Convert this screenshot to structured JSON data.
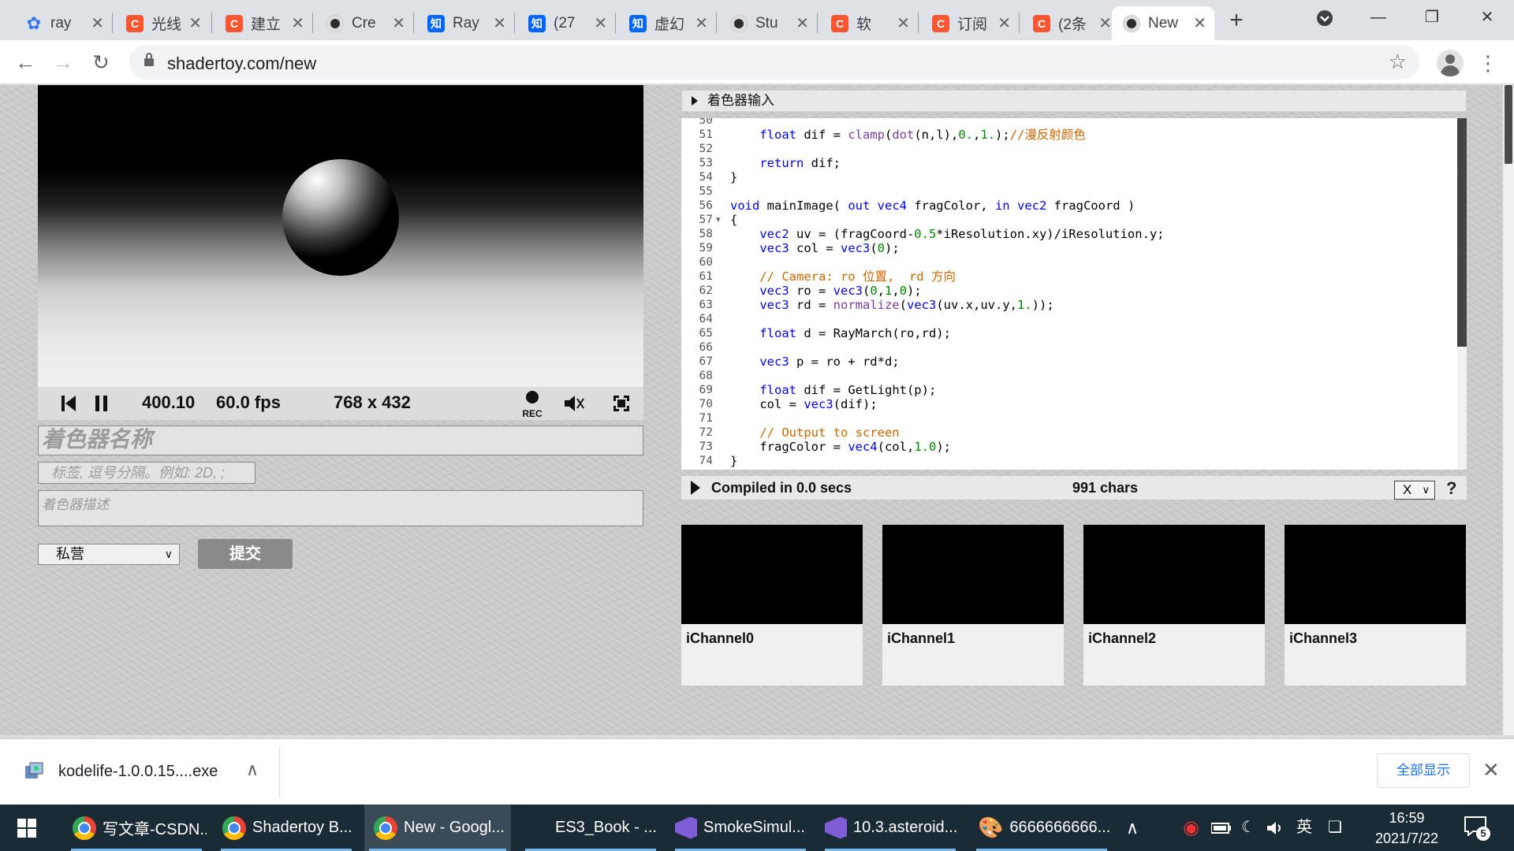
{
  "browser": {
    "tabs": [
      {
        "label": "ray",
        "favicon": "paw-icon"
      },
      {
        "label": "光线",
        "favicon": "csdn-icon"
      },
      {
        "label": "建立",
        "favicon": "csdn-icon"
      },
      {
        "label": "Cre",
        "favicon": "shadertoy-icon"
      },
      {
        "label": "Ray",
        "favicon": "zhihu-icon"
      },
      {
        "label": "(27",
        "favicon": "zhihu-icon"
      },
      {
        "label": "虚幻",
        "favicon": "zhihu-icon"
      },
      {
        "label": "Stu",
        "favicon": "shadertoy-icon"
      },
      {
        "label": "软",
        "favicon": "csdn-icon"
      },
      {
        "label": "订阅",
        "favicon": "csdn-icon"
      },
      {
        "label": "(2条",
        "favicon": "csdn-icon"
      },
      {
        "label": "New",
        "favicon": "shadertoy-icon",
        "active": true
      }
    ],
    "url": "shadertoy.com/new"
  },
  "player": {
    "time": "400.10",
    "fps": "60.0 fps",
    "resolution": "768 x 432",
    "rec_label": "REC"
  },
  "form": {
    "name_placeholder": "着色器名称",
    "tags_placeholder": "标签, 逗号分隔。例如: 2D, ;",
    "description_placeholder": "着色器描述",
    "visibility": "私营",
    "submit_label": "提交"
  },
  "editor": {
    "header": "着色器输入",
    "lines": [
      {
        "n": "50",
        "code": ""
      },
      {
        "n": "51",
        "code": "    float dif = clamp(dot(n,l),0.,1.);//漫反射颜色"
      },
      {
        "n": "52",
        "code": ""
      },
      {
        "n": "53",
        "code": "    return dif;"
      },
      {
        "n": "54",
        "code": "}"
      },
      {
        "n": "55",
        "code": ""
      },
      {
        "n": "56",
        "code": "void mainImage( out vec4 fragColor, in vec2 fragCoord )"
      },
      {
        "n": "57",
        "code": "{"
      },
      {
        "n": "58",
        "code": "    vec2 uv = (fragCoord-0.5*iResolution.xy)/iResolution.y;"
      },
      {
        "n": "59",
        "code": "    vec3 col = vec3(0);"
      },
      {
        "n": "60",
        "code": ""
      },
      {
        "n": "61",
        "code": "    // Camera: ro 位置,  rd 方向"
      },
      {
        "n": "62",
        "code": "    vec3 ro = vec3(0,1,0);"
      },
      {
        "n": "63",
        "code": "    vec3 rd = normalize(vec3(uv.x,uv.y,1.));"
      },
      {
        "n": "64",
        "code": ""
      },
      {
        "n": "65",
        "code": "    float d = RayMarch(ro,rd);"
      },
      {
        "n": "66",
        "code": ""
      },
      {
        "n": "67",
        "code": "    vec3 p = ro + rd*d;"
      },
      {
        "n": "68",
        "code": ""
      },
      {
        "n": "69",
        "code": "    float dif = GetLight(p);"
      },
      {
        "n": "70",
        "code": "    col = vec3(dif);"
      },
      {
        "n": "71",
        "code": ""
      },
      {
        "n": "72",
        "code": "    // Output to screen"
      },
      {
        "n": "73",
        "code": "    fragColor = vec4(col,1.0);"
      },
      {
        "n": "74",
        "code": "}"
      }
    ],
    "status": "Compiled in 0.0 secs",
    "chars": "991 chars",
    "select_value": "X",
    "help_label": "?"
  },
  "channels": [
    "iChannel0",
    "iChannel1",
    "iChannel2",
    "iChannel3"
  ],
  "download": {
    "filename": "kodelife-1.0.0.15....exe",
    "show_all": "全部显示"
  },
  "taskbar": {
    "items": [
      {
        "label": "写文章-CSDN...",
        "icon": "chrome-icon"
      },
      {
        "label": "Shadertoy B...",
        "icon": "chrome-icon"
      },
      {
        "label": "New - Googl...",
        "icon": "chrome-icon",
        "active": true
      },
      {
        "label": "ES3_Book - ...",
        "icon": "none"
      },
      {
        "label": "SmokeSimul...",
        "icon": "visual-studio-icon"
      },
      {
        "label": "10.3.asteroid...",
        "icon": "visual-studio-icon"
      },
      {
        "label": "6666666666...",
        "icon": "paint-icon"
      }
    ],
    "ime": "英",
    "time": "16:59",
    "date": "2021/7/22",
    "notifications": "5"
  }
}
